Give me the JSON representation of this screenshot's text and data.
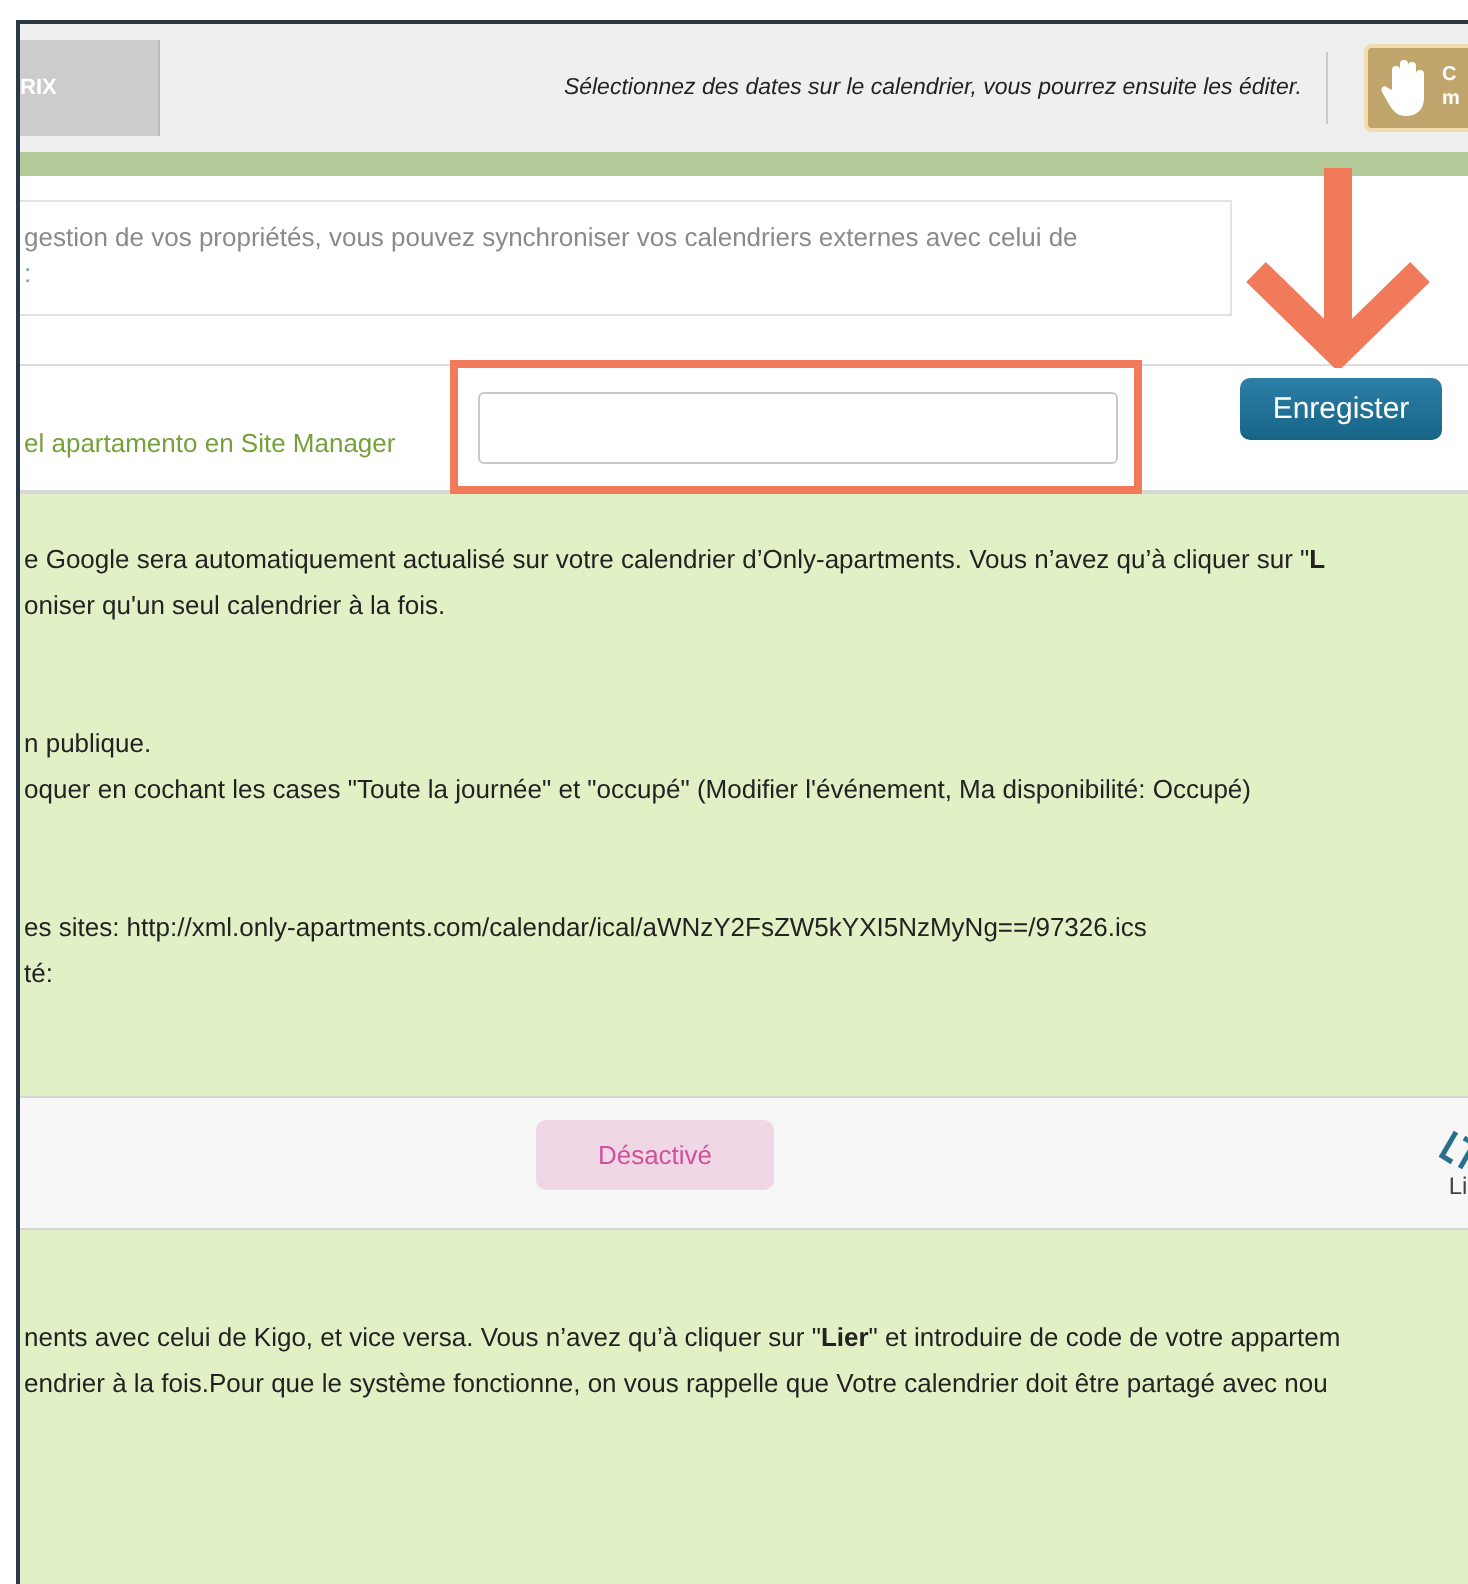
{
  "header": {
    "logo_text": "RIX",
    "hint": "Sélectionnez des dates sur le calendrier, vous pourrez ensuite les éditer.",
    "action_button": [
      "C",
      "m"
    ]
  },
  "info_box": {
    "lines": [
      "gestion de vos propriétés, vous pouvez synchroniser vos calendriers externes avec celui de",
      ":"
    ]
  },
  "sync_row": {
    "label": "el apartamento en Site Manager",
    "button": "Enregister"
  },
  "google_section": {
    "paragraphs": [
      [
        "e Google sera automatiquement actualisé sur votre calendrier d’Only-apartments. Vous n’avez qu’à cliquer sur \"**L**",
        "oniser qu'un seul calendrier à la fois."
      ],
      [
        "n publique.",
        "oquer en cochant les cases \"Toute la journée\" et \"occupé\" (Modifier l'événement, Ma disponibilité: Occupé)"
      ],
      [
        "es sites: http://xml.only-apartments.com/calendar/ical/aWNzY2FsZW5kYXI5NzMyNg==/97326.ics",
        "té:"
      ]
    ]
  },
  "kigo_strip": {
    "status": "Désactivé",
    "active": false,
    "link_label": "Li"
  },
  "kigo_section": {
    "paragraphs": [
      [
        "nents avec celui de Kigo, et vice versa. Vous n’avez qu’à cliquer sur \"**Lier**\" et introduire de code de votre appartem",
        "endrier à la fois.Pour que le système fonctionne, on vous rappelle que Votre calendrier doit être partagé avec nou"
      ]
    ]
  }
}
